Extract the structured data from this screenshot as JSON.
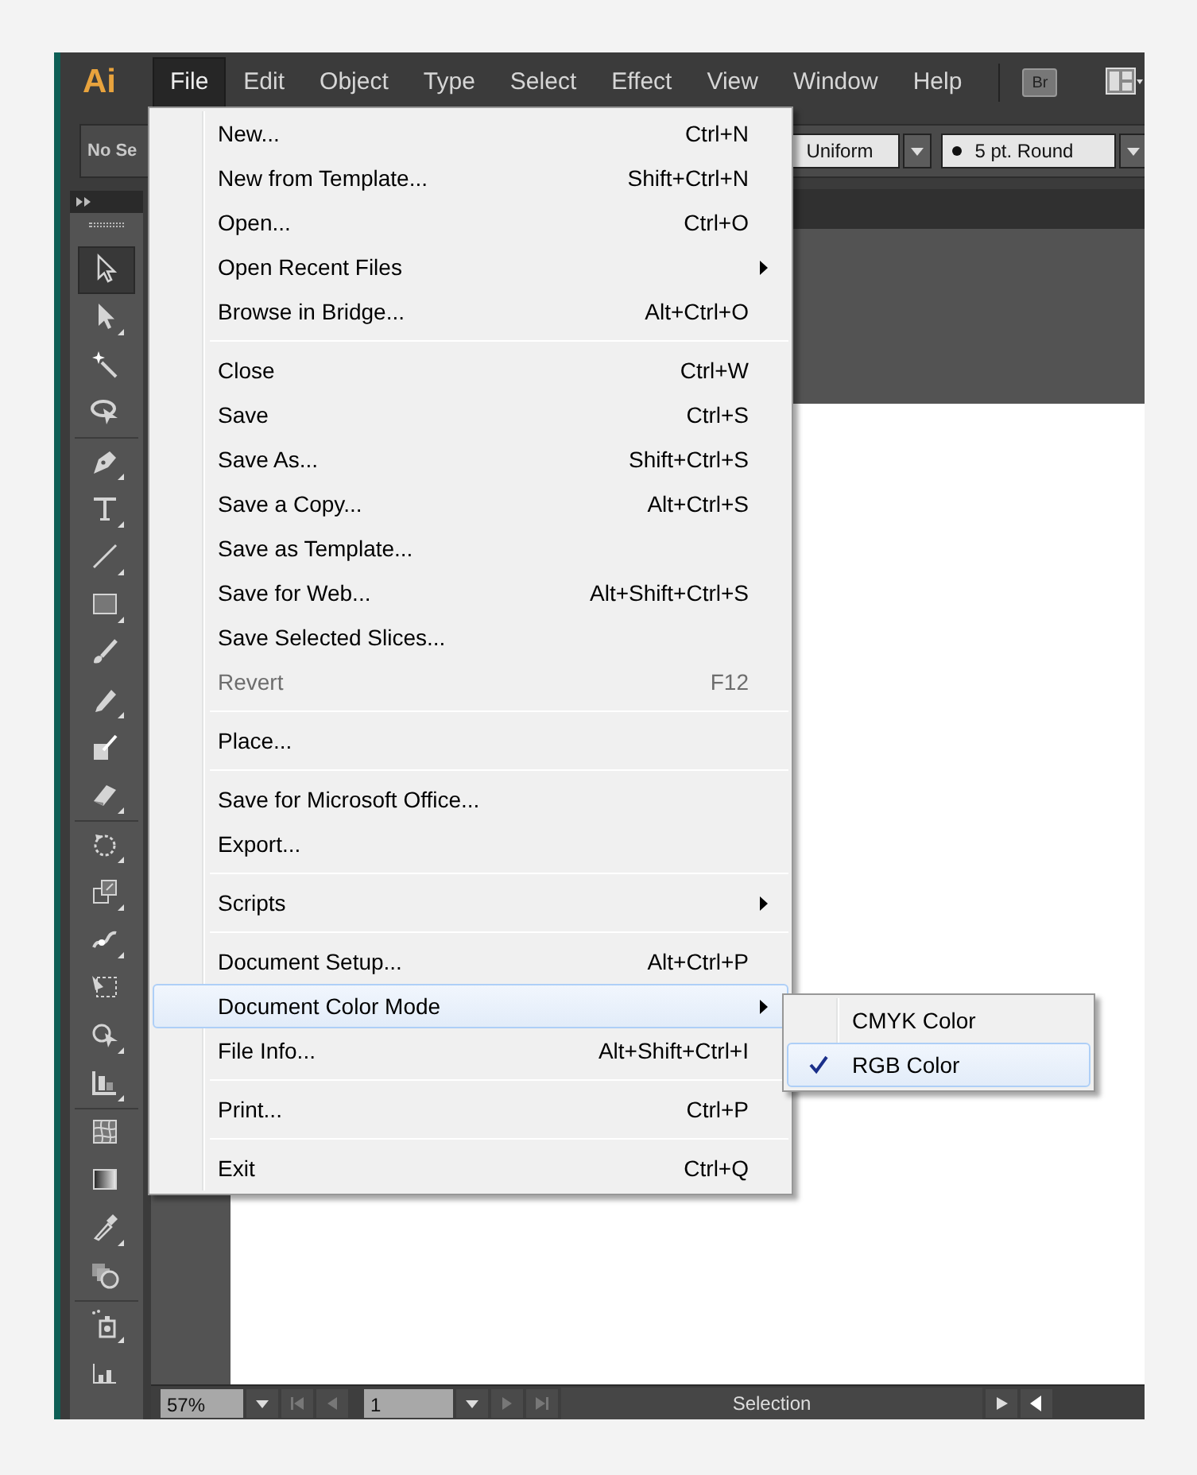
{
  "app": {
    "logo": "Ai"
  },
  "menu_bar": [
    {
      "label": "File",
      "selected": true
    },
    {
      "label": "Edit",
      "selected": false
    },
    {
      "label": "Object",
      "selected": false
    },
    {
      "label": "Type",
      "selected": false
    },
    {
      "label": "Select",
      "selected": false
    },
    {
      "label": "Effect",
      "selected": false
    },
    {
      "label": "View",
      "selected": false
    },
    {
      "label": "Window",
      "selected": false
    },
    {
      "label": "Help",
      "selected": false
    }
  ],
  "bridge_button": "Br",
  "control_bar": {
    "selection_label": "No Se",
    "stroke_profile": "Uniform",
    "brush": "5 pt. Round"
  },
  "tools": [
    [
      {
        "selected": true,
        "flyout": false
      },
      {
        "selected": false,
        "flyout": true
      },
      {
        "selected": false,
        "flyout": false
      },
      {
        "selected": false,
        "flyout": false
      }
    ],
    [
      {
        "selected": false,
        "flyout": true
      },
      {
        "selected": false,
        "flyout": true
      },
      {
        "selected": false,
        "flyout": true
      },
      {
        "selected": false,
        "flyout": true
      },
      {
        "selected": false,
        "flyout": false
      },
      {
        "selected": false,
        "flyout": true
      },
      {
        "selected": false,
        "flyout": false
      },
      {
        "selected": false,
        "flyout": true
      }
    ],
    [
      {
        "selected": false,
        "flyout": true
      },
      {
        "selected": false,
        "flyout": true
      },
      {
        "selected": false,
        "flyout": true
      },
      {
        "selected": false,
        "flyout": false
      },
      {
        "selected": false,
        "flyout": true
      },
      {
        "selected": false,
        "flyout": true
      }
    ],
    [
      {
        "selected": false,
        "flyout": false
      },
      {
        "selected": false,
        "flyout": false
      },
      {
        "selected": false,
        "flyout": true
      },
      {
        "selected": false,
        "flyout": false
      }
    ],
    [
      {
        "selected": false,
        "flyout": true
      },
      {
        "selected": false,
        "flyout": false
      }
    ]
  ],
  "status_bar": {
    "zoom": "57%",
    "page": "1",
    "tool": "Selection"
  },
  "file_menu": [
    [
      {
        "label": "New...",
        "shortcut": "Ctrl+N",
        "disabled": false,
        "submenu": false,
        "selected": false
      },
      {
        "label": "New from Template...",
        "shortcut": "Shift+Ctrl+N",
        "disabled": false,
        "submenu": false,
        "selected": false
      },
      {
        "label": "Open...",
        "shortcut": "Ctrl+O",
        "disabled": false,
        "submenu": false,
        "selected": false
      },
      {
        "label": "Open Recent Files",
        "disabled": false,
        "submenu": true,
        "selected": false
      },
      {
        "label": "Browse in Bridge...",
        "shortcut": "Alt+Ctrl+O",
        "disabled": false,
        "submenu": false,
        "selected": false
      }
    ],
    [
      {
        "label": "Close",
        "shortcut": "Ctrl+W",
        "disabled": false,
        "submenu": false,
        "selected": false
      },
      {
        "label": "Save",
        "shortcut": "Ctrl+S",
        "disabled": false,
        "submenu": false,
        "selected": false
      },
      {
        "label": "Save As...",
        "shortcut": "Shift+Ctrl+S",
        "disabled": false,
        "submenu": false,
        "selected": false
      },
      {
        "label": "Save a Copy...",
        "shortcut": "Alt+Ctrl+S",
        "disabled": false,
        "submenu": false,
        "selected": false
      },
      {
        "label": "Save as Template...",
        "disabled": false,
        "submenu": false,
        "selected": false
      },
      {
        "label": "Save for Web...",
        "shortcut": "Alt+Shift+Ctrl+S",
        "disabled": false,
        "submenu": false,
        "selected": false
      },
      {
        "label": "Save Selected Slices...",
        "disabled": false,
        "submenu": false,
        "selected": false
      },
      {
        "label": "Revert",
        "shortcut": "F12",
        "disabled": true,
        "submenu": false,
        "selected": false
      }
    ],
    [
      {
        "label": "Place...",
        "disabled": false,
        "submenu": false,
        "selected": false
      }
    ],
    [
      {
        "label": "Save for Microsoft Office...",
        "disabled": false,
        "submenu": false,
        "selected": false
      },
      {
        "label": "Export...",
        "disabled": false,
        "submenu": false,
        "selected": false
      }
    ],
    [
      {
        "label": "Scripts",
        "disabled": false,
        "submenu": true,
        "selected": false
      }
    ],
    [
      {
        "label": "Document Setup...",
        "shortcut": "Alt+Ctrl+P",
        "disabled": false,
        "submenu": false,
        "selected": false
      },
      {
        "label": "Document Color Mode",
        "disabled": false,
        "submenu": true,
        "selected": true
      },
      {
        "label": "File Info...",
        "shortcut": "Alt+Shift+Ctrl+I",
        "disabled": false,
        "submenu": false,
        "selected": false
      }
    ],
    [
      {
        "label": "Print...",
        "shortcut": "Ctrl+P",
        "disabled": false,
        "submenu": false,
        "selected": false
      }
    ],
    [
      {
        "label": "Exit",
        "shortcut": "Ctrl+Q",
        "disabled": false,
        "submenu": false,
        "selected": false
      }
    ]
  ],
  "color_mode_submenu": [
    {
      "label": "CMYK Color",
      "checked": false,
      "selected": false
    },
    {
      "label": "RGB Color",
      "checked": true,
      "selected": true
    }
  ]
}
